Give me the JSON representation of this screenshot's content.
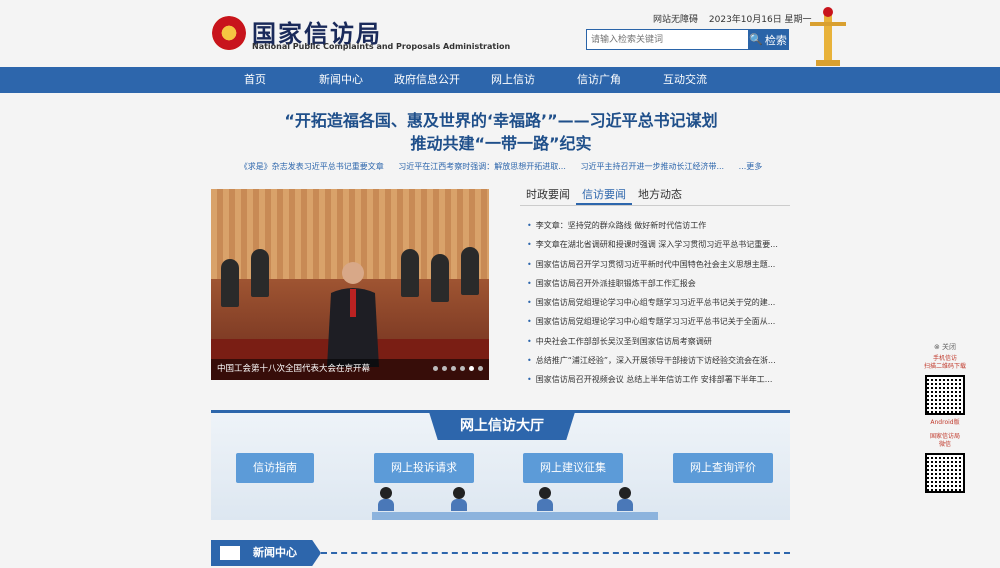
{
  "header": {
    "title_cn": "国家信访局",
    "title_en": "National Public Complaints and Proposals Administration",
    "accessibility": "网站无障碍",
    "date": "2023年10月16日 星期一",
    "search_placeholder": "请输入检索关键词",
    "search_button": "检索"
  },
  "nav": [
    "首页",
    "新闻中心",
    "政府信息公开",
    "网上信访",
    "信访广角",
    "互动交流"
  ],
  "headline": {
    "line1": "“开拓造福各国、惠及世界的‘幸福路’”——习近平总书记谋划",
    "line2": "推动共建“一带一路”纪实"
  },
  "sublinks": [
    "《求是》杂志发表习近平总书记重要文章",
    "习近平在江西考察时强调：解放思想开拓进取...",
    "习近平主持召开进一步推动长江经济带...",
    "...更多"
  ],
  "carousel": {
    "caption": "中国工会第十八次全国代表大会在京开幕",
    "active_slide": 5,
    "slide_count": 6
  },
  "tabs": [
    {
      "label": "时政要闻",
      "active": false
    },
    {
      "label": "信访要闻",
      "active": true
    },
    {
      "label": "地方动态",
      "active": false
    }
  ],
  "news": [
    "李文章：坚持党的群众路线 做好新时代信访工作",
    "李文章在湖北省调研和授课时强调 深入学习贯彻习近平总书记重要...",
    "国家信访局召开学习贯彻习近平新时代中国特色社会主义思想主题...",
    "国家信访局召开外派挂职锻炼干部工作汇报会",
    "国家信访局党组理论学习中心组专题学习习近平总书记关于党的建...",
    "国家信访局党组理论学习中心组专题学习习近平总书记关于全面从...",
    "中央社会工作部部长吴汉圣到国家信访局考察调研",
    "总结推广“浦江经验”，深入开展领导干部接访下访经验交流会在浙...",
    "国家信访局召开视频会议 总结上半年信访工作 安排部署下半年工..."
  ],
  "hall": {
    "title": "网上信访大厅",
    "buttons": [
      "信访指南",
      "网上投诉请求",
      "网上建议征集",
      "网上查询评价"
    ]
  },
  "section_title": "新闻中心",
  "sidebar": {
    "close": "⊗ 关闭",
    "mobile_label": "手机信访\n扫描二维码下载",
    "android_label": "Android版",
    "wechat_label": "国家信访局\n微信"
  },
  "colors": {
    "primary": "#2d66ac",
    "headline": "#1f4f8a"
  }
}
